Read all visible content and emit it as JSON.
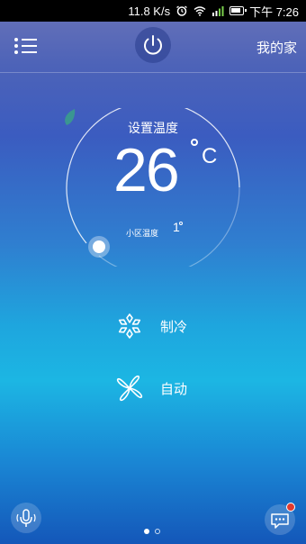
{
  "status_bar": {
    "network_speed": "11.8 K/s",
    "time": "下午 7:26",
    "icons": [
      "alarm-icon",
      "wifi-icon",
      "signal-icon",
      "battery-icon"
    ]
  },
  "header": {
    "menu_icon": "menu-list-icon",
    "power_icon": "power-icon",
    "home_title": "我的家"
  },
  "thermostat": {
    "set_label": "设置温度",
    "set_temperature": "26",
    "unit": "C",
    "leaf_icon": "leaf-icon",
    "community_label": "小区温度",
    "community_temperature": "1"
  },
  "modes": [
    {
      "icon": "snowflake-icon",
      "label": "制冷"
    },
    {
      "icon": "fan-icon",
      "label": "自动"
    }
  ],
  "footer": {
    "voice_icon": "microphone-icon",
    "chat_icon": "chat-bubble-icon",
    "has_notification": true,
    "page_count": 2,
    "current_page": 1
  },
  "colors": {
    "notification_badge": "#e23a2e",
    "leaf": "#3aa08a"
  }
}
